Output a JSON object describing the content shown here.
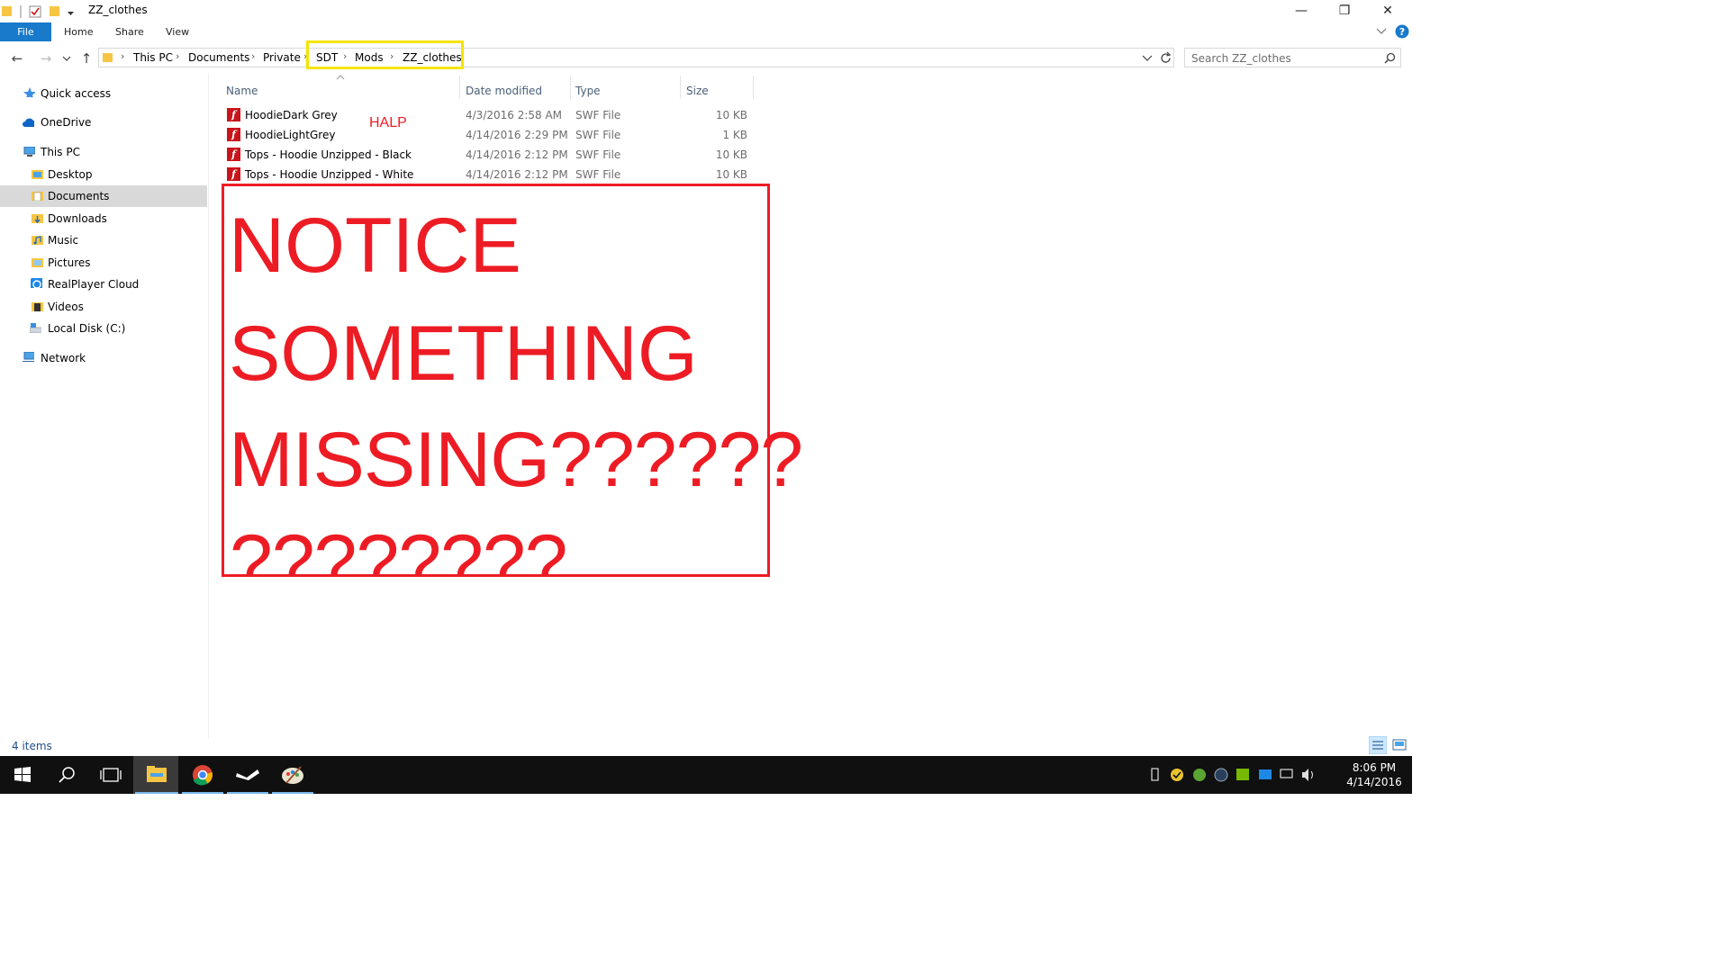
{
  "window": {
    "title": "ZZ_clothes",
    "controls": {
      "minimize": "—",
      "maximize": "❐",
      "close": "✕"
    }
  },
  "ribbon": {
    "tabs": [
      "File",
      "Home",
      "Share",
      "View"
    ]
  },
  "address": {
    "crumbs": [
      "This PC",
      "Documents",
      "Private",
      "SDT",
      "Mods",
      "ZZ_clothes"
    ]
  },
  "search": {
    "placeholder": "Search ZZ_clothes"
  },
  "sidebar": {
    "items": [
      {
        "label": "Quick access",
        "icon": "star-icon"
      },
      {
        "label": "OneDrive",
        "icon": "cloud-icon"
      },
      {
        "label": "This PC",
        "icon": "computer-icon"
      },
      {
        "label": "Desktop",
        "icon": "folder-icon"
      },
      {
        "label": "Documents",
        "icon": "documents-icon",
        "selected": true
      },
      {
        "label": "Downloads",
        "icon": "downloads-icon"
      },
      {
        "label": "Music",
        "icon": "music-icon"
      },
      {
        "label": "Pictures",
        "icon": "pictures-icon"
      },
      {
        "label": "RealPlayer Cloud",
        "icon": "realplayer-icon"
      },
      {
        "label": "Videos",
        "icon": "videos-icon"
      },
      {
        "label": "Local Disk (C:)",
        "icon": "disk-icon"
      },
      {
        "label": "Network",
        "icon": "network-icon"
      }
    ]
  },
  "columns": {
    "name": "Name",
    "date": "Date modified",
    "type": "Type",
    "size": "Size"
  },
  "files": [
    {
      "name": "HoodieDark Grey",
      "date": "4/3/2016 2:58 AM",
      "type": "SWF File",
      "size": "10 KB"
    },
    {
      "name": "HoodieLightGrey",
      "date": "4/14/2016 2:29 PM",
      "type": "SWF File",
      "size": "1 KB"
    },
    {
      "name": "Tops - Hoodie Unzipped - Black",
      "date": "4/14/2016 2:12 PM",
      "type": "SWF File",
      "size": "10 KB"
    },
    {
      "name": "Tops - Hoodie Unzipped - White",
      "date": "4/14/2016 2:12 PM",
      "type": "SWF File",
      "size": "10 KB"
    }
  ],
  "annotation": {
    "halp": "HALP",
    "lines": [
      "NOTICE",
      "SOMETHING",
      "MISSING??????",
      "????????"
    ]
  },
  "status": {
    "items": "4 items"
  },
  "taskbar": {
    "time": "8:06 PM",
    "date": "4/14/2016"
  },
  "colors": {
    "accent": "#1979ca",
    "annotation_red": "#ed1c24",
    "highlight_yellow": "#f3e500",
    "taskbar": "#101010"
  }
}
